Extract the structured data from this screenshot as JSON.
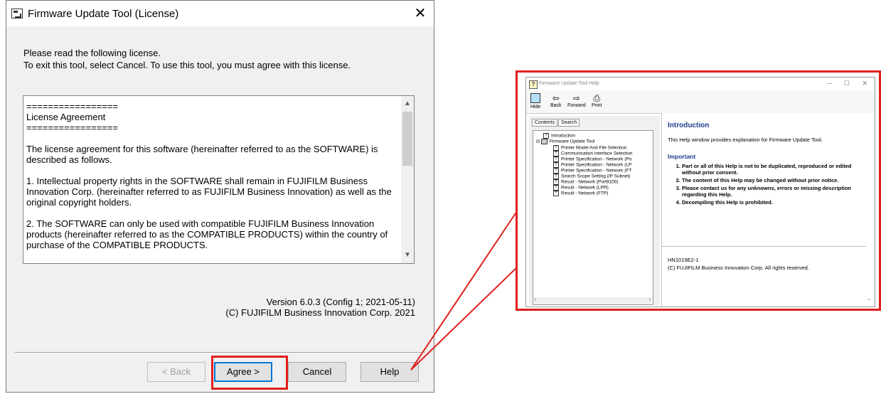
{
  "dialog": {
    "title": "Firmware Update Tool (License)",
    "close_glyph": "✕",
    "intro_line1": "Please read the following license.",
    "intro_line2": "To exit this tool, select Cancel. To use this tool, you must agree with this license.",
    "license_text": "=================\nLicense Agreement\n=================\n\nThe license agreement for this software (hereinafter referred to as the SOFTWARE) is described as follows.\n\n1. Intellectual property rights in the SOFTWARE shall remain in FUJIFILM Business Innovation Corp. (hereinafter referred to as FUJIFILM Business Innovation) as well as the original copyright holders.\n\n2. The SOFTWARE can only be used with compatible FUJIFILM Business Innovation products (hereinafter referred to as the COMPATIBLE PRODUCTS) within the country of purchase of the COMPATIBLE PRODUCTS.",
    "version": "Version 6.0.3 (Config 1; 2021-05-11)",
    "copyright": "(C) FUJIFILM Business Innovation Corp. 2021",
    "buttons": {
      "back": "< Back",
      "agree": "Agree >",
      "cancel": "Cancel",
      "help": "Help"
    }
  },
  "help_window": {
    "title": "Firmware Update Tool Help",
    "toolbar": {
      "hide": "Hide",
      "back": "Back",
      "forward": "Forward",
      "print": "Print"
    },
    "tabs": [
      "Contents",
      "Search"
    ],
    "tree": [
      "Introduction",
      "Firmware Update Tool",
      "Printer Model And File Selection",
      "Communication interface Selection",
      "Printer Specification - Network (Po",
      "Printer Specification - Network (LP",
      "Printer Specification - Network (FT",
      "Search Scope Setting (IP Subnet)",
      "Result - Network (Port9100)",
      "Result - Network (LPR)",
      "Result - Network (FTP)"
    ],
    "content": {
      "heading": "Introduction",
      "intro": "This Help window provides explanation for Firmware Update Tool.",
      "important": "Important",
      "items": [
        "Part or all of this Help is not to be duplicated, reproduced or edited without prior consent.",
        "The content of this Help may be changed without prior notice.",
        "Please contact us for any unknowns, errors or missing description regarding this Help.",
        "Decompiling this Help is prohibited."
      ],
      "code": "HN1019E2-1",
      "copyright": "(C) FUJIFILM Business Innovation Corp. All rights reserved."
    }
  },
  "colors": {
    "highlight": "#e0201c",
    "heading_blue": "#1f3e8c"
  }
}
